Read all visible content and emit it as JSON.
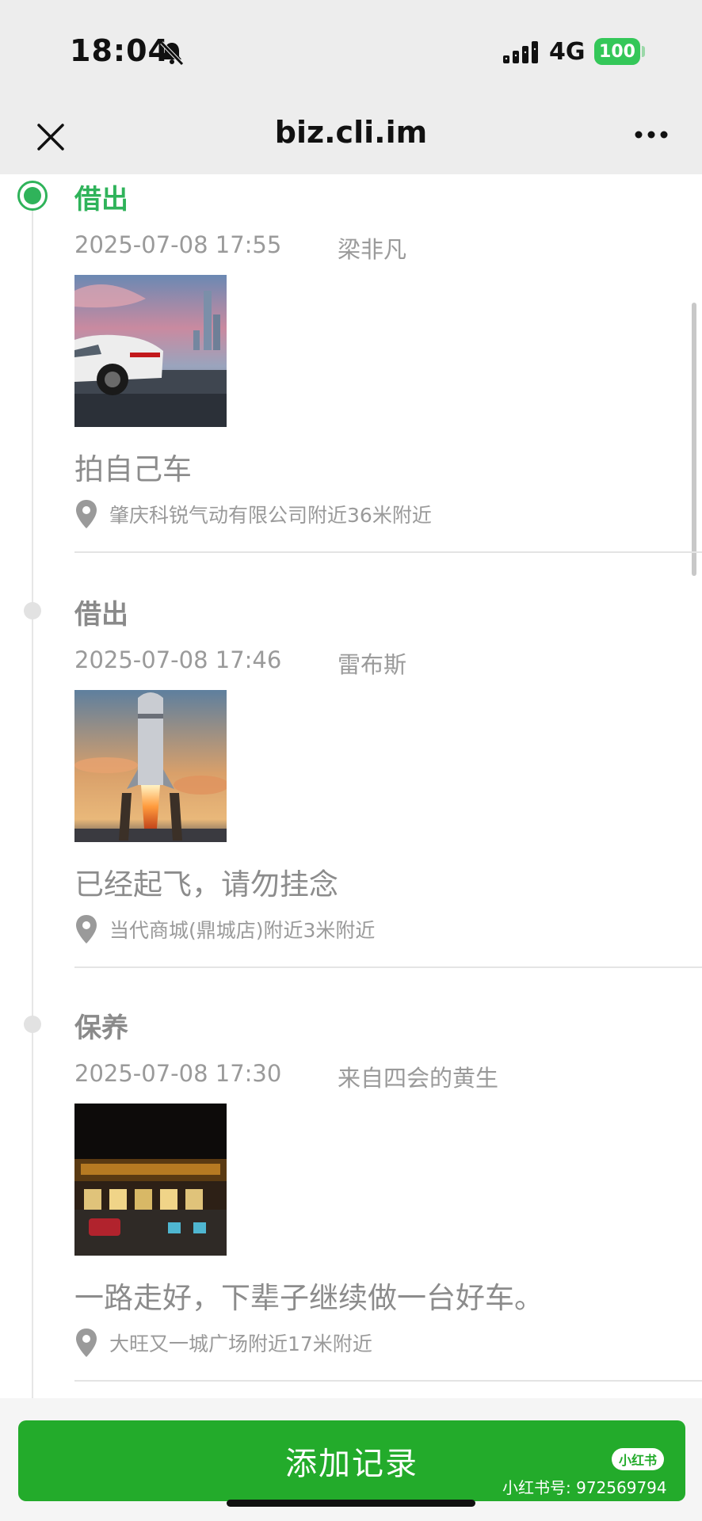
{
  "status_bar": {
    "time": "18:04",
    "network": "4G",
    "battery": "100"
  },
  "header": {
    "url": "biz.cli.im"
  },
  "entries": [
    {
      "title": "借出",
      "time": "2025-07-08 17:55",
      "user": "梁非凡",
      "note": "拍自己车",
      "location": "肇庆科锐气动有限公司附近36米附近",
      "photo": "white-car-photo",
      "active": true
    },
    {
      "title": "借出",
      "time": "2025-07-08 17:46",
      "user": "雷布斯",
      "note": "已经起飞，请勿挂念",
      "location": "当代商城(鼎城店)附近3米附近",
      "photo": "rocket-launch-photo",
      "active": false
    },
    {
      "title": "保养",
      "time": "2025-07-08 17:30",
      "user": "来自四会的黄生",
      "note": "一路走好，下辈子继续做一台好车。",
      "location": "大旺又一城广场附近17米附近",
      "photo": "night-tollgate-photo",
      "active": false
    }
  ],
  "bottom": {
    "add_record": "添加记录",
    "watermark_badge": "小红书",
    "watermark_id": "小红书号: 972569794"
  },
  "colors": {
    "accent_green": "#2fb35a",
    "button_green": "#23ab2b"
  }
}
